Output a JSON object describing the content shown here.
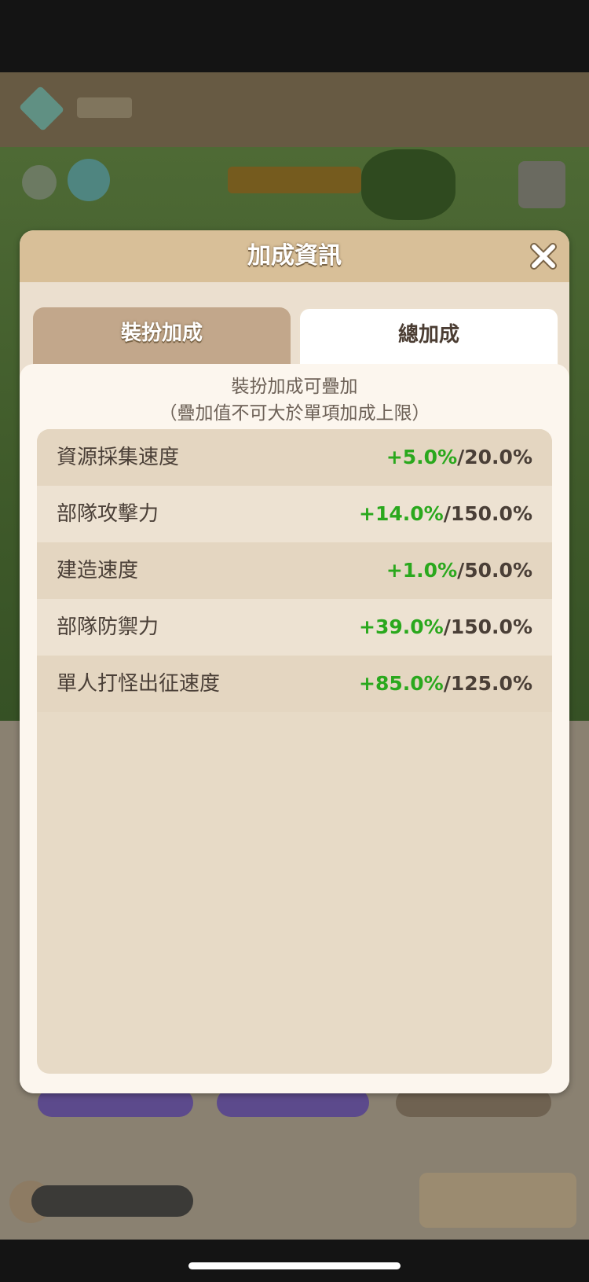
{
  "modal": {
    "title": "加成資訊",
    "tabs": [
      {
        "label": "裝扮加成",
        "selected": false
      },
      {
        "label": "總加成",
        "selected": true
      }
    ],
    "note_line1": "裝扮加成可疊加",
    "note_line2": "（疊加值不可大於單項加成上限）",
    "rows": [
      {
        "label": "資源採集速度",
        "bonus": "+5.0%",
        "cap": "/20.0%"
      },
      {
        "label": "部隊攻擊力",
        "bonus": "+14.0%",
        "cap": "/150.0%"
      },
      {
        "label": "建造速度",
        "bonus": "+1.0%",
        "cap": "/50.0%"
      },
      {
        "label": "部隊防禦力",
        "bonus": "+39.0%",
        "cap": "/150.0%"
      },
      {
        "label": "單人打怪出征速度",
        "bonus": "+85.0%",
        "cap": "/125.0%"
      }
    ]
  },
  "icons": {
    "close": "close-icon"
  },
  "colors": {
    "bonus": "#2aa81d",
    "header": "#d8bf98",
    "accent_text": "#4a3f37"
  }
}
